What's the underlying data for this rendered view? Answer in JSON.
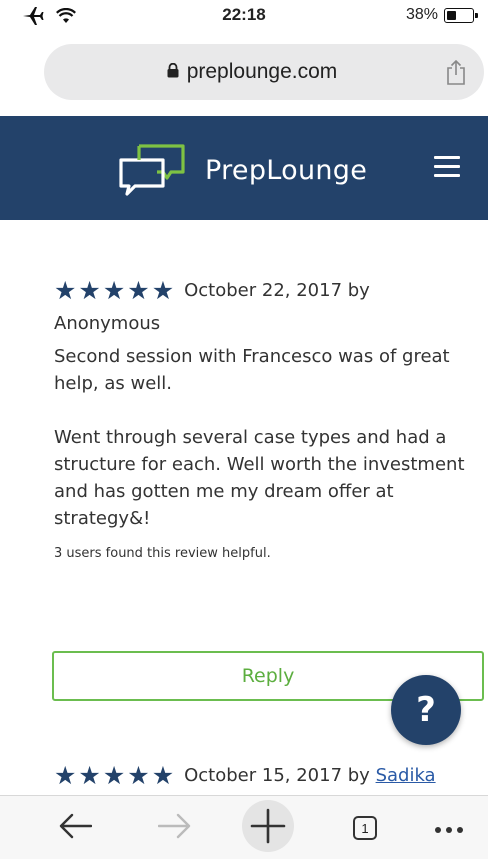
{
  "status_bar": {
    "time": "22:18",
    "battery": "38%",
    "battery_level": 0.38
  },
  "browser": {
    "url": "preplounge.com"
  },
  "site": {
    "brand": "PrepLounge",
    "accent": "#23426a",
    "reply_color": "#5cae3f"
  },
  "reviews": [
    {
      "rating": 5,
      "date": "October 22, 2017 by",
      "author": "Anonymous",
      "paragraphs": [
        "Second session with Francesco was of great help, as well.",
        "Went through several case types and had a structure for each. Well worth the investment and has gotten me my dream offer at strategy&!"
      ],
      "helpful": "3 users found this review helpful.",
      "reply_label": "Reply"
    },
    {
      "rating": 5,
      "date": "October 15, 2017 by",
      "author": "Sadika"
    }
  ],
  "help_button": {
    "label": "?"
  },
  "toolbar": {
    "tabs_count": "1"
  },
  "icons": [
    "airplane-icon",
    "wifi-icon",
    "lock-icon",
    "share-icon",
    "logo-icon",
    "menu-icon",
    "star-icon",
    "back-icon",
    "forward-icon",
    "new-tab-icon",
    "more-icon"
  ]
}
